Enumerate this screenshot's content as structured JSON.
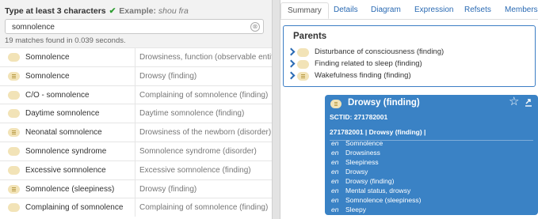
{
  "search": {
    "hint_label": "Type at least 3 characters",
    "hint_check": "✔",
    "example_label": "Example:",
    "example_value": "shou fra",
    "value": "somnolence",
    "clear_icon": "⊗",
    "status": "19 matches found in 0.039 seconds."
  },
  "results": [
    {
      "term": "Somnolence",
      "fsn": "Drowsiness, function (observable entity)",
      "primitive": false
    },
    {
      "term": "Somnolence",
      "fsn": "Drowsy (finding)",
      "primitive": true
    },
    {
      "term": "C/O - somnolence",
      "fsn": "Complaining of somnolence (finding)",
      "primitive": false
    },
    {
      "term": "Daytime somnolence",
      "fsn": "Daytime somnolence (finding)",
      "primitive": false
    },
    {
      "term": "Neonatal somnolence",
      "fsn": "Drowsiness of the newborn (disorder)",
      "primitive": true
    },
    {
      "term": "Somnolence syndrome",
      "fsn": "Somnolence syndrome (disorder)",
      "primitive": false
    },
    {
      "term": "Excessive somnolence",
      "fsn": "Excessive somnolence (finding)",
      "primitive": false
    },
    {
      "term": "Somnolence (sleepiness)",
      "fsn": "Drowsy (finding)",
      "primitive": true
    },
    {
      "term": "Complaining of somnolence",
      "fsn": "Complaining of somnolence (finding)",
      "primitive": false
    }
  ],
  "tabs": [
    "Summary",
    "Details",
    "Diagram",
    "Expression",
    "Refsets",
    "Members"
  ],
  "parents": {
    "title": "Parents",
    "items": [
      {
        "label": "Disturbance of consciousness (finding)",
        "primitive": false
      },
      {
        "label": "Finding related to sleep (finding)",
        "primitive": false
      },
      {
        "label": "Wakefulness finding (finding)",
        "primitive": true
      }
    ]
  },
  "concept": {
    "title": "Drowsy (finding)",
    "sctid": "SCTID: 271782001",
    "fsn_line": "271782001 | Drowsy (finding) |",
    "star_icon": "☆",
    "descriptions": [
      {
        "lang": "en",
        "term": "Somnolence"
      },
      {
        "lang": "en",
        "term": "Drowsiness"
      },
      {
        "lang": "en",
        "term": "Sleepiness"
      },
      {
        "lang": "en",
        "term": "Drowsy"
      },
      {
        "lang": "en",
        "term": "Drowsy (finding)"
      },
      {
        "lang": "en",
        "term": "Mental status, drowsy"
      },
      {
        "lang": "en",
        "term": "Somnolence (sleepiness)"
      },
      {
        "lang": "en",
        "term": "Sleepy"
      }
    ]
  },
  "colors": {
    "accent": "#3a82c5",
    "link": "#2a6ab3",
    "check": "#2e9d32",
    "badge": "#f2e3b7"
  }
}
